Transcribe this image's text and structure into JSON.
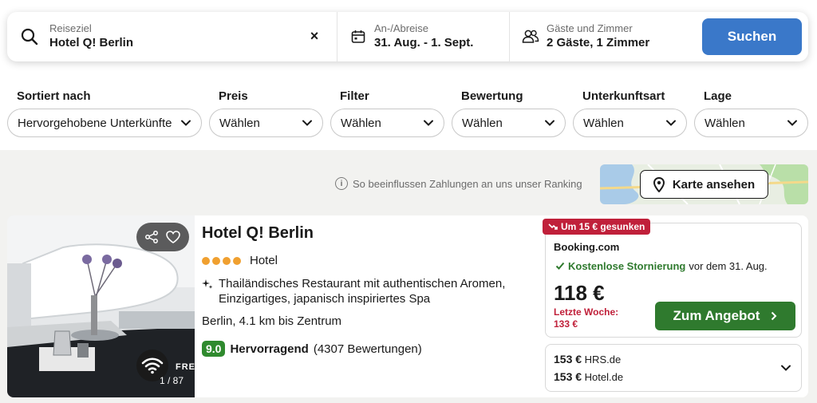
{
  "search": {
    "destination_label": "Reiseziel",
    "destination_value": "Hotel Q! Berlin",
    "clear_label": "×",
    "dates_label": "An-/Abreise",
    "dates_value": "31. Aug. - 1. Sept.",
    "guests_label": "Gäste und Zimmer",
    "guests_value": "2 Gäste, 1 Zimmer",
    "search_button": "Suchen",
    "search_button_color": "#3a78c9"
  },
  "filters": [
    {
      "label": "Sortiert nach",
      "value": "Hervorgehobene Unterkünfte"
    },
    {
      "label": "Preis",
      "value": "Wählen"
    },
    {
      "label": "Filter",
      "value": "Wählen"
    },
    {
      "label": "Bewertung",
      "value": "Wählen"
    },
    {
      "label": "Unterkunftsart",
      "value": "Wählen"
    },
    {
      "label": "Lage",
      "value": "Wählen"
    }
  ],
  "results": {
    "ranking_info": "So beeinflussen Zahlungen an uns unser Ranking",
    "map_button": "Karte ansehen"
  },
  "hotel": {
    "name": "Hotel Q! Berlin",
    "type": "Hotel",
    "stars": 4,
    "feature": "Thailändisches Restaurant mit authentischen Aromen, Einzigartiges, japanisch inspiriertes Spa",
    "location": "Berlin, 4.1 km bis Zentrum",
    "score": "9.0",
    "rating_label": "Hervorragend",
    "reviews": "(4307 Bewertungen)",
    "photo_count": "1 / 87",
    "photo_overlay_text": "FRE"
  },
  "offer": {
    "price_drop": "Um 15 € gesunken",
    "provider": "Booking.com",
    "cancellation": "Kostenlose Stornierung",
    "cancellation_until": "vor dem 31. Aug.",
    "price": "118 €",
    "last_week_label": "Letzte Woche:",
    "last_week_price": "133 €",
    "deal_button": "Zum Angebot",
    "deal_color": "#2f7a2e",
    "drop_color": "#c0203a"
  },
  "other_offers": [
    {
      "price": "153 €",
      "provider": "HRS.de"
    },
    {
      "price": "153 €",
      "provider": "Hotel.de"
    }
  ]
}
